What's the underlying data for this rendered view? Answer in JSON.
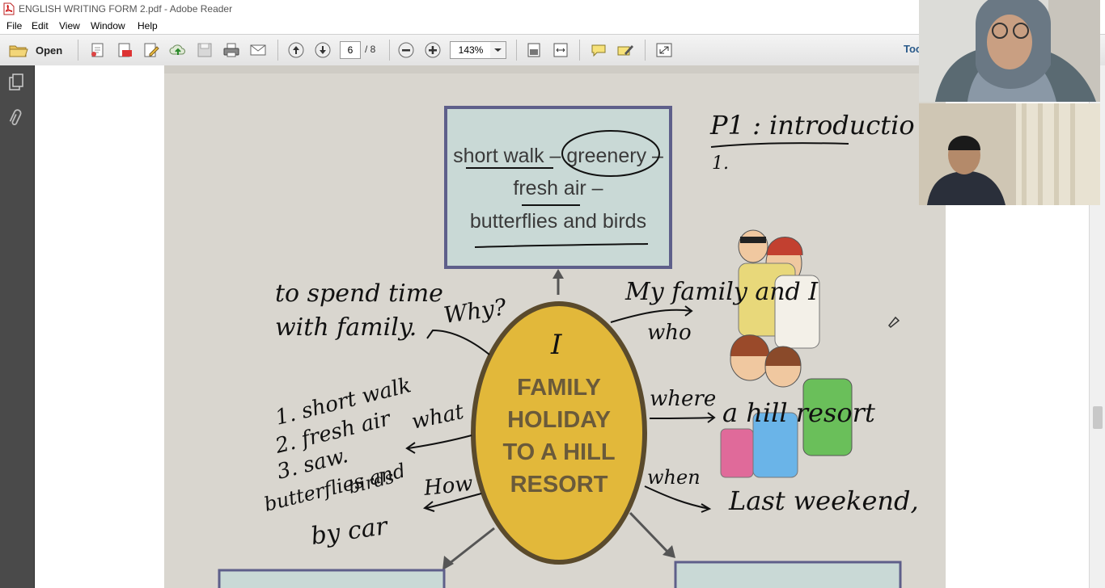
{
  "window": {
    "title": "ENGLISH WRITING FORM 2.pdf - Adobe Reader"
  },
  "menu": [
    "File",
    "Edit",
    "View",
    "Window",
    "Help"
  ],
  "toolbar": {
    "open_label": "Open",
    "page_current": "6",
    "page_total": "/ 8",
    "zoom": "143%",
    "tools_label": "Too"
  },
  "mindmap": {
    "top_box": [
      "short walk – greenery –",
      "fresh air –",
      "butterflies and birds"
    ],
    "center": [
      "FAMILY",
      "HOLIDAY",
      "TO A HILL",
      "RESORT"
    ]
  },
  "annotations": {
    "p1": "P1 :  introductio",
    "p1_item": "1.",
    "why_answer_1": "to spend time",
    "why_answer_2": "with family.",
    "why": "Why?",
    "who_answer": "My family and I",
    "who": "who",
    "center_mark": "I",
    "what_list_1": "1. short walk",
    "what_list_2": "2. fresh air",
    "what_list_3": "3. saw.",
    "what_list_4": "butterflies and",
    "what_list_5": "birds",
    "what": "what",
    "where": "where",
    "where_answer": "a hill  resort",
    "how": "How",
    "how_answer": "by car",
    "when": "when",
    "when_answer": "Last weekend,"
  },
  "colors": {
    "page": "#d9d6cf",
    "ink": "#111111",
    "center_fill": "#e2b83a",
    "box_fill": "#c9d9d6"
  }
}
